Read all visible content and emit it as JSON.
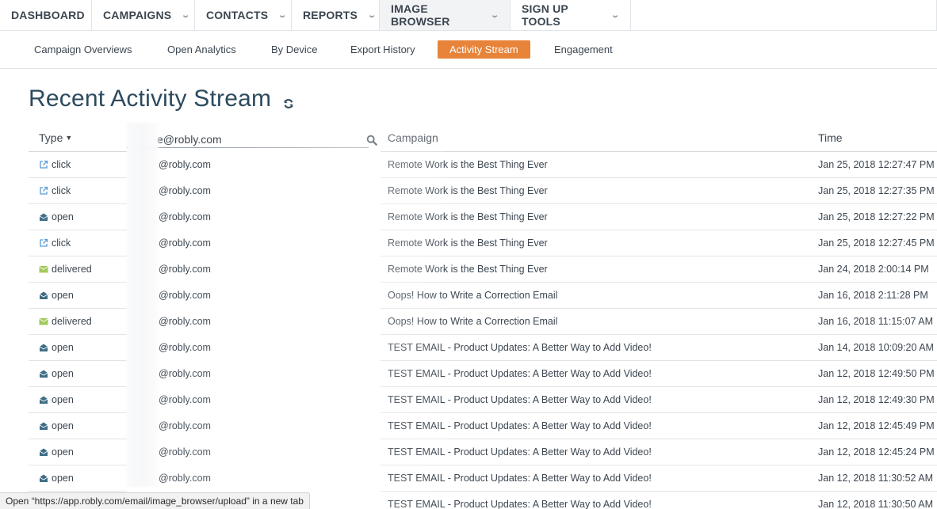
{
  "topnav": {
    "items": [
      {
        "label": "DASHBOARD",
        "caret": false
      },
      {
        "label": "CAMPAIGNS",
        "caret": true
      },
      {
        "label": "CONTACTS",
        "caret": true
      },
      {
        "label": "REPORTS",
        "caret": true
      },
      {
        "label": "IMAGE BROWSER",
        "caret": true,
        "active": true
      },
      {
        "label": "SIGN UP TOOLS",
        "caret": true
      }
    ]
  },
  "subnav": {
    "items": [
      {
        "label": "Campaign Overviews"
      },
      {
        "label": "Open Analytics"
      },
      {
        "label": "By Device"
      },
      {
        "label": "Export History"
      },
      {
        "label": "Activity Stream",
        "active": true
      },
      {
        "label": "Engagement"
      }
    ]
  },
  "page": {
    "title": "Recent Activity Stream"
  },
  "table": {
    "col_type": "Type",
    "email_filter_value": "e@robly.com",
    "col_campaign": "Campaign",
    "col_time": "Time",
    "rows": [
      {
        "type": "click",
        "icon": "external-link-icon",
        "email": "@robly.com",
        "campaign": "Remote Work is the Best Thing Ever",
        "time": "Jan 25, 2018 12:27:47 PM"
      },
      {
        "type": "click",
        "icon": "external-link-icon",
        "email": "@robly.com",
        "campaign": "Remote Work is the Best Thing Ever",
        "time": "Jan 25, 2018 12:27:35 PM"
      },
      {
        "type": "open",
        "icon": "open-envelope-icon",
        "email": "@robly.com",
        "campaign": "Remote Work is the Best Thing Ever",
        "time": "Jan 25, 2018 12:27:22 PM"
      },
      {
        "type": "click",
        "icon": "external-link-icon",
        "email": "@robly.com",
        "campaign": "Remote Work is the Best Thing Ever",
        "time": "Jan 25, 2018 12:27:45 PM"
      },
      {
        "type": "delivered",
        "icon": "envelope-icon",
        "email": "@robly.com",
        "campaign": "Remote Work is the Best Thing Ever",
        "time": "Jan 24, 2018 2:00:14 PM"
      },
      {
        "type": "open",
        "icon": "open-envelope-icon",
        "email": "@robly.com",
        "campaign": "Oops! How to Write a Correction Email",
        "time": "Jan 16, 2018 2:11:28 PM"
      },
      {
        "type": "delivered",
        "icon": "envelope-icon",
        "email": "@robly.com",
        "campaign": "Oops! How to Write a Correction Email",
        "time": "Jan 16, 2018 11:15:07 AM"
      },
      {
        "type": "open",
        "icon": "open-envelope-icon",
        "email": "@robly.com",
        "campaign": "TEST EMAIL - Product Updates: A Better Way to Add Video!",
        "time": "Jan 14, 2018 10:09:20 AM"
      },
      {
        "type": "open",
        "icon": "open-envelope-icon",
        "email": "@robly.com",
        "campaign": "TEST EMAIL - Product Updates: A Better Way to Add Video!",
        "time": "Jan 12, 2018 12:49:50 PM"
      },
      {
        "type": "open",
        "icon": "open-envelope-icon",
        "email": "@robly.com",
        "campaign": "TEST EMAIL - Product Updates: A Better Way to Add Video!",
        "time": "Jan 12, 2018 12:49:30 PM"
      },
      {
        "type": "open",
        "icon": "open-envelope-icon",
        "email": "@robly.com",
        "campaign": "TEST EMAIL - Product Updates: A Better Way to Add Video!",
        "time": "Jan 12, 2018 12:45:49 PM"
      },
      {
        "type": "open",
        "icon": "open-envelope-icon",
        "email": "@robly.com",
        "campaign": "TEST EMAIL - Product Updates: A Better Way to Add Video!",
        "time": "Jan 12, 2018 12:45:24 PM"
      },
      {
        "type": "open",
        "icon": "open-envelope-icon",
        "email": "@robly.com",
        "campaign": "TEST EMAIL - Product Updates: A Better Way to Add Video!",
        "time": "Jan 12, 2018 11:30:52 AM"
      },
      {
        "type": "",
        "icon": "",
        "email": "",
        "campaign": "TEST EMAIL - Product Updates: A Better Way to Add Video!",
        "time": "Jan 12, 2018 11:30:50 AM"
      }
    ]
  },
  "statusbar": {
    "text": "Open “https://app.robly.com/email/image_browser/upload” in a new tab"
  },
  "colors": {
    "accent": "#e8833a",
    "title": "#2d4a5e",
    "text": "#3c4650",
    "icon_link": "#5b9bd5",
    "icon_open": "#3f6d85",
    "icon_delivered": "#a3c95a"
  }
}
